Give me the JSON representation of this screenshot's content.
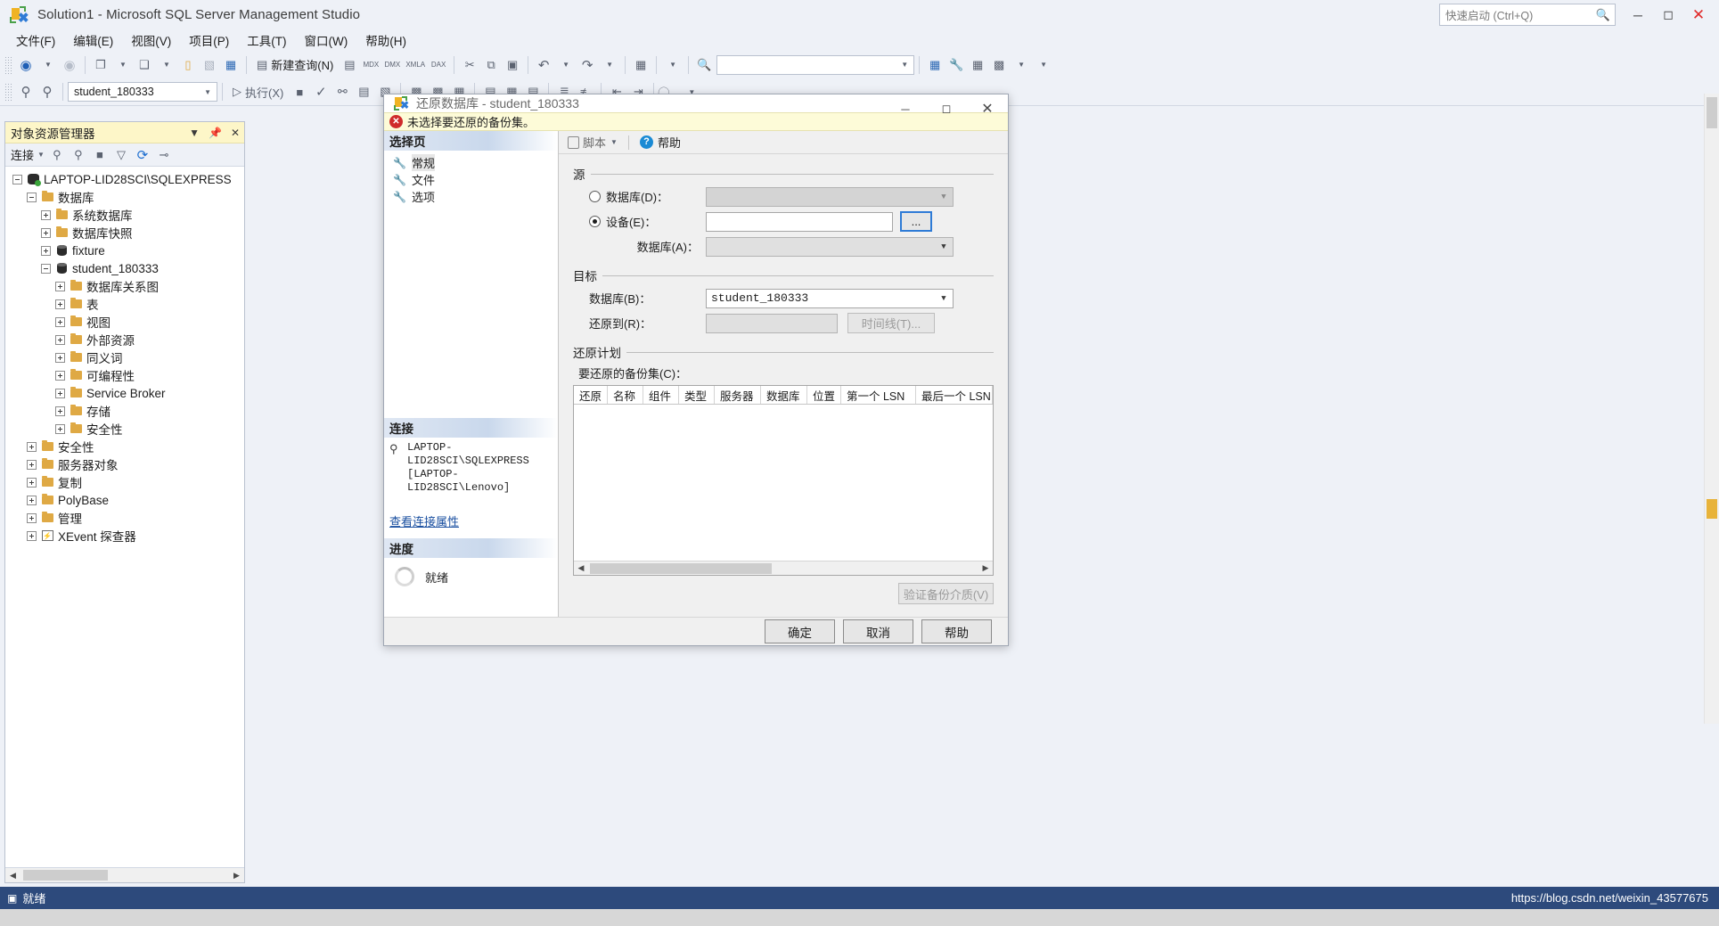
{
  "window": {
    "title": "Solution1 - Microsoft SQL Server Management Studio",
    "logo_icon": "ssms-logo-icon",
    "minimize_icon": "minimize-icon",
    "maximize_icon": "maximize-icon",
    "close_icon": "close-icon"
  },
  "quick_launch": {
    "placeholder": "快速启动 (Ctrl+Q)",
    "icon": "search-icon"
  },
  "menubar": {
    "items": [
      {
        "label": "文件(F)"
      },
      {
        "label": "编辑(E)"
      },
      {
        "label": "视图(V)"
      },
      {
        "label": "项目(P)"
      },
      {
        "label": "工具(T)"
      },
      {
        "label": "窗口(W)"
      },
      {
        "label": "帮助(H)"
      }
    ]
  },
  "toolbar_main": {
    "new_query_label": "新建查询(N)",
    "buttons": [
      {
        "name": "navigate-back-icon",
        "glyph": "◀"
      },
      {
        "name": "navigate-forward-icon",
        "glyph": "▶"
      },
      {
        "name": "new-project-icon",
        "glyph": "❏"
      },
      {
        "name": "new-item-icon",
        "glyph": "❑"
      },
      {
        "name": "open-file-icon",
        "glyph": "📂"
      },
      {
        "name": "save-icon",
        "glyph": "▤"
      },
      {
        "name": "save-all-icon",
        "glyph": "▥"
      },
      {
        "name": "new-query-icon",
        "glyph": "▤"
      },
      {
        "name": "new-analysis-query-icon",
        "glyph": "▤"
      },
      {
        "name": "new-mdx-query-icon",
        "glyph": "MDX"
      },
      {
        "name": "new-dmx-query-icon",
        "glyph": "DMX"
      },
      {
        "name": "new-xmla-query-icon",
        "glyph": "XMLA"
      },
      {
        "name": "new-dax-query-icon",
        "glyph": "DAX"
      },
      {
        "name": "cut-icon",
        "glyph": "✂"
      },
      {
        "name": "copy-icon",
        "glyph": "⧉"
      },
      {
        "name": "paste-icon",
        "glyph": "📋"
      },
      {
        "name": "undo-icon",
        "glyph": "↶"
      },
      {
        "name": "redo-icon",
        "glyph": "↷"
      },
      {
        "name": "show-plan-icon",
        "glyph": "▦"
      },
      {
        "name": "find-icon",
        "glyph": "🔎"
      }
    ],
    "search_value": ""
  },
  "toolbar_query": {
    "database_value": "student_180333",
    "execute_label": "执行(X)",
    "buttons": [
      {
        "name": "connect-icon",
        "glyph": "⚲"
      },
      {
        "name": "disconnect-icon",
        "glyph": "⚲"
      },
      {
        "name": "execute-arrow-icon",
        "glyph": "▷"
      },
      {
        "name": "stop-icon",
        "glyph": "■"
      },
      {
        "name": "parse-icon",
        "glyph": "✓"
      },
      {
        "name": "display-estimated-plan-icon",
        "glyph": "⚯"
      },
      {
        "name": "include-actual-plan-icon",
        "glyph": "▤"
      },
      {
        "name": "include-client-statistics-icon",
        "glyph": "▤"
      },
      {
        "name": "query-options-icon",
        "glyph": "▥"
      },
      {
        "name": "results-to-text-icon",
        "glyph": "▤"
      },
      {
        "name": "results-to-grid-icon",
        "glyph": "▦"
      },
      {
        "name": "results-to-file-icon",
        "glyph": "▤"
      },
      {
        "name": "comment-icon",
        "glyph": "≡"
      },
      {
        "name": "uncomment-icon",
        "glyph": "≢"
      },
      {
        "name": "decrease-indent-icon",
        "glyph": "⇤"
      },
      {
        "name": "increase-indent-icon",
        "glyph": "⇥"
      },
      {
        "name": "specify-values-icon",
        "glyph": "@"
      }
    ]
  },
  "object_explorer": {
    "title": "对象资源管理器",
    "dropdown_icon": "chevron-down-icon",
    "pin_icon": "pin-icon",
    "close_icon": "close-icon",
    "connect_label": "连接",
    "toolbar_icons": [
      {
        "name": "connect-object-explorer-icon",
        "glyph": "⚲"
      },
      {
        "name": "disconnect-object-explorer-icon",
        "glyph": "⚲"
      },
      {
        "name": "stop-icon",
        "glyph": "■"
      },
      {
        "name": "filter-icon",
        "glyph": "▽"
      },
      {
        "name": "refresh-icon",
        "glyph": "⟳"
      },
      {
        "name": "activity-monitor-icon",
        "glyph": "⩘"
      }
    ],
    "tree": [
      {
        "label": "LAPTOP-LID28SCI\\SQLEXPRESS",
        "depth": 0,
        "state": "expanded",
        "icon": "server-icon"
      },
      {
        "label": "数据库",
        "depth": 1,
        "state": "expanded",
        "icon": "folder-icon"
      },
      {
        "label": "系统数据库",
        "depth": 2,
        "state": "collapsed",
        "icon": "folder-icon"
      },
      {
        "label": "数据库快照",
        "depth": 2,
        "state": "collapsed",
        "icon": "folder-icon"
      },
      {
        "label": "fixture",
        "depth": 2,
        "state": "collapsed",
        "icon": "database-icon"
      },
      {
        "label": "student_180333",
        "depth": 2,
        "state": "expanded",
        "icon": "database-icon"
      },
      {
        "label": "数据库关系图",
        "depth": 3,
        "state": "collapsed",
        "icon": "folder-icon"
      },
      {
        "label": "表",
        "depth": 3,
        "state": "collapsed",
        "icon": "folder-icon"
      },
      {
        "label": "视图",
        "depth": 3,
        "state": "collapsed",
        "icon": "folder-icon"
      },
      {
        "label": "外部资源",
        "depth": 3,
        "state": "collapsed",
        "icon": "folder-icon"
      },
      {
        "label": "同义词",
        "depth": 3,
        "state": "collapsed",
        "icon": "folder-icon"
      },
      {
        "label": "可编程性",
        "depth": 3,
        "state": "collapsed",
        "icon": "folder-icon"
      },
      {
        "label": "Service Broker",
        "depth": 3,
        "state": "collapsed",
        "icon": "folder-icon"
      },
      {
        "label": "存储",
        "depth": 3,
        "state": "collapsed",
        "icon": "folder-icon"
      },
      {
        "label": "安全性",
        "depth": 3,
        "state": "collapsed",
        "icon": "folder-icon"
      },
      {
        "label": "安全性",
        "depth": 1,
        "state": "collapsed",
        "icon": "folder-icon"
      },
      {
        "label": "服务器对象",
        "depth": 1,
        "state": "collapsed",
        "icon": "folder-icon"
      },
      {
        "label": "复制",
        "depth": 1,
        "state": "collapsed",
        "icon": "folder-icon"
      },
      {
        "label": "PolyBase",
        "depth": 1,
        "state": "collapsed",
        "icon": "folder-icon"
      },
      {
        "label": "管理",
        "depth": 1,
        "state": "collapsed",
        "icon": "folder-icon"
      },
      {
        "label": "XEvent 探查器",
        "depth": 1,
        "state": "collapsed",
        "icon": "xevent-icon"
      }
    ]
  },
  "dialog": {
    "title": "还原数据库 - student_180333",
    "logo_icon": "ssms-logo-icon",
    "minimize_icon": "minimize-icon",
    "maximize_icon": "maximize-icon",
    "close_icon": "close-icon",
    "alert": {
      "icon": "error-icon",
      "message": "未选择要还原的备份集。"
    },
    "left": {
      "pages_header": "选择页",
      "pages": [
        {
          "label": "常规",
          "icon": "wrench-icon",
          "selected": true
        },
        {
          "label": "文件",
          "icon": "wrench-icon",
          "selected": false
        },
        {
          "label": "选项",
          "icon": "wrench-icon",
          "selected": false
        }
      ],
      "connection_header": "连接",
      "connection_icon": "connection-icon",
      "connection_line1": "LAPTOP-LID28SCI\\SQLEXPRESS",
      "connection_line2": "[LAPTOP-LID28SCI\\Lenovo]",
      "view_connection_link": "查看连接属性",
      "progress_header": "进度",
      "progress_icon": "spinner-icon",
      "progress_text": "就绪"
    },
    "rtoolbar": {
      "script_label": "脚本",
      "script_icon": "script-icon",
      "script_caret_icon": "chevron-down-icon",
      "help_label": "帮助",
      "help_icon": "help-icon"
    },
    "source": {
      "group_label": "源",
      "database_radio_label": "数据库(D)",
      "database_radio_selected": false,
      "database_value": "",
      "device_radio_label": "设备(E)",
      "device_radio_selected": true,
      "device_value": "",
      "device_browse_label": "...",
      "device_database_label": "数据库(A)",
      "device_database_value": ""
    },
    "target": {
      "group_label": "目标",
      "database_label": "数据库(B)",
      "database_value": "student_180333",
      "restore_to_label": "还原到(R)",
      "restore_to_value": "",
      "timeline_button_label": "时间线(T)..."
    },
    "restore_plan": {
      "group_label": "还原计划",
      "backup_sets_label": "要还原的备份集(C)：",
      "columns": [
        "还原",
        "名称",
        "组件",
        "类型",
        "服务器",
        "数据库",
        "位置",
        "第一个 LSN",
        "最后一个 LSN"
      ],
      "rows": [],
      "verify_button_label": "验证备份介质(V)"
    },
    "footer": {
      "ok_label": "确定",
      "cancel_label": "取消",
      "help_label": "帮助"
    }
  },
  "statusbar": {
    "icon": "ready-icon",
    "text": "就绪",
    "url": "https://blog.csdn.net/weixin_43577675"
  }
}
